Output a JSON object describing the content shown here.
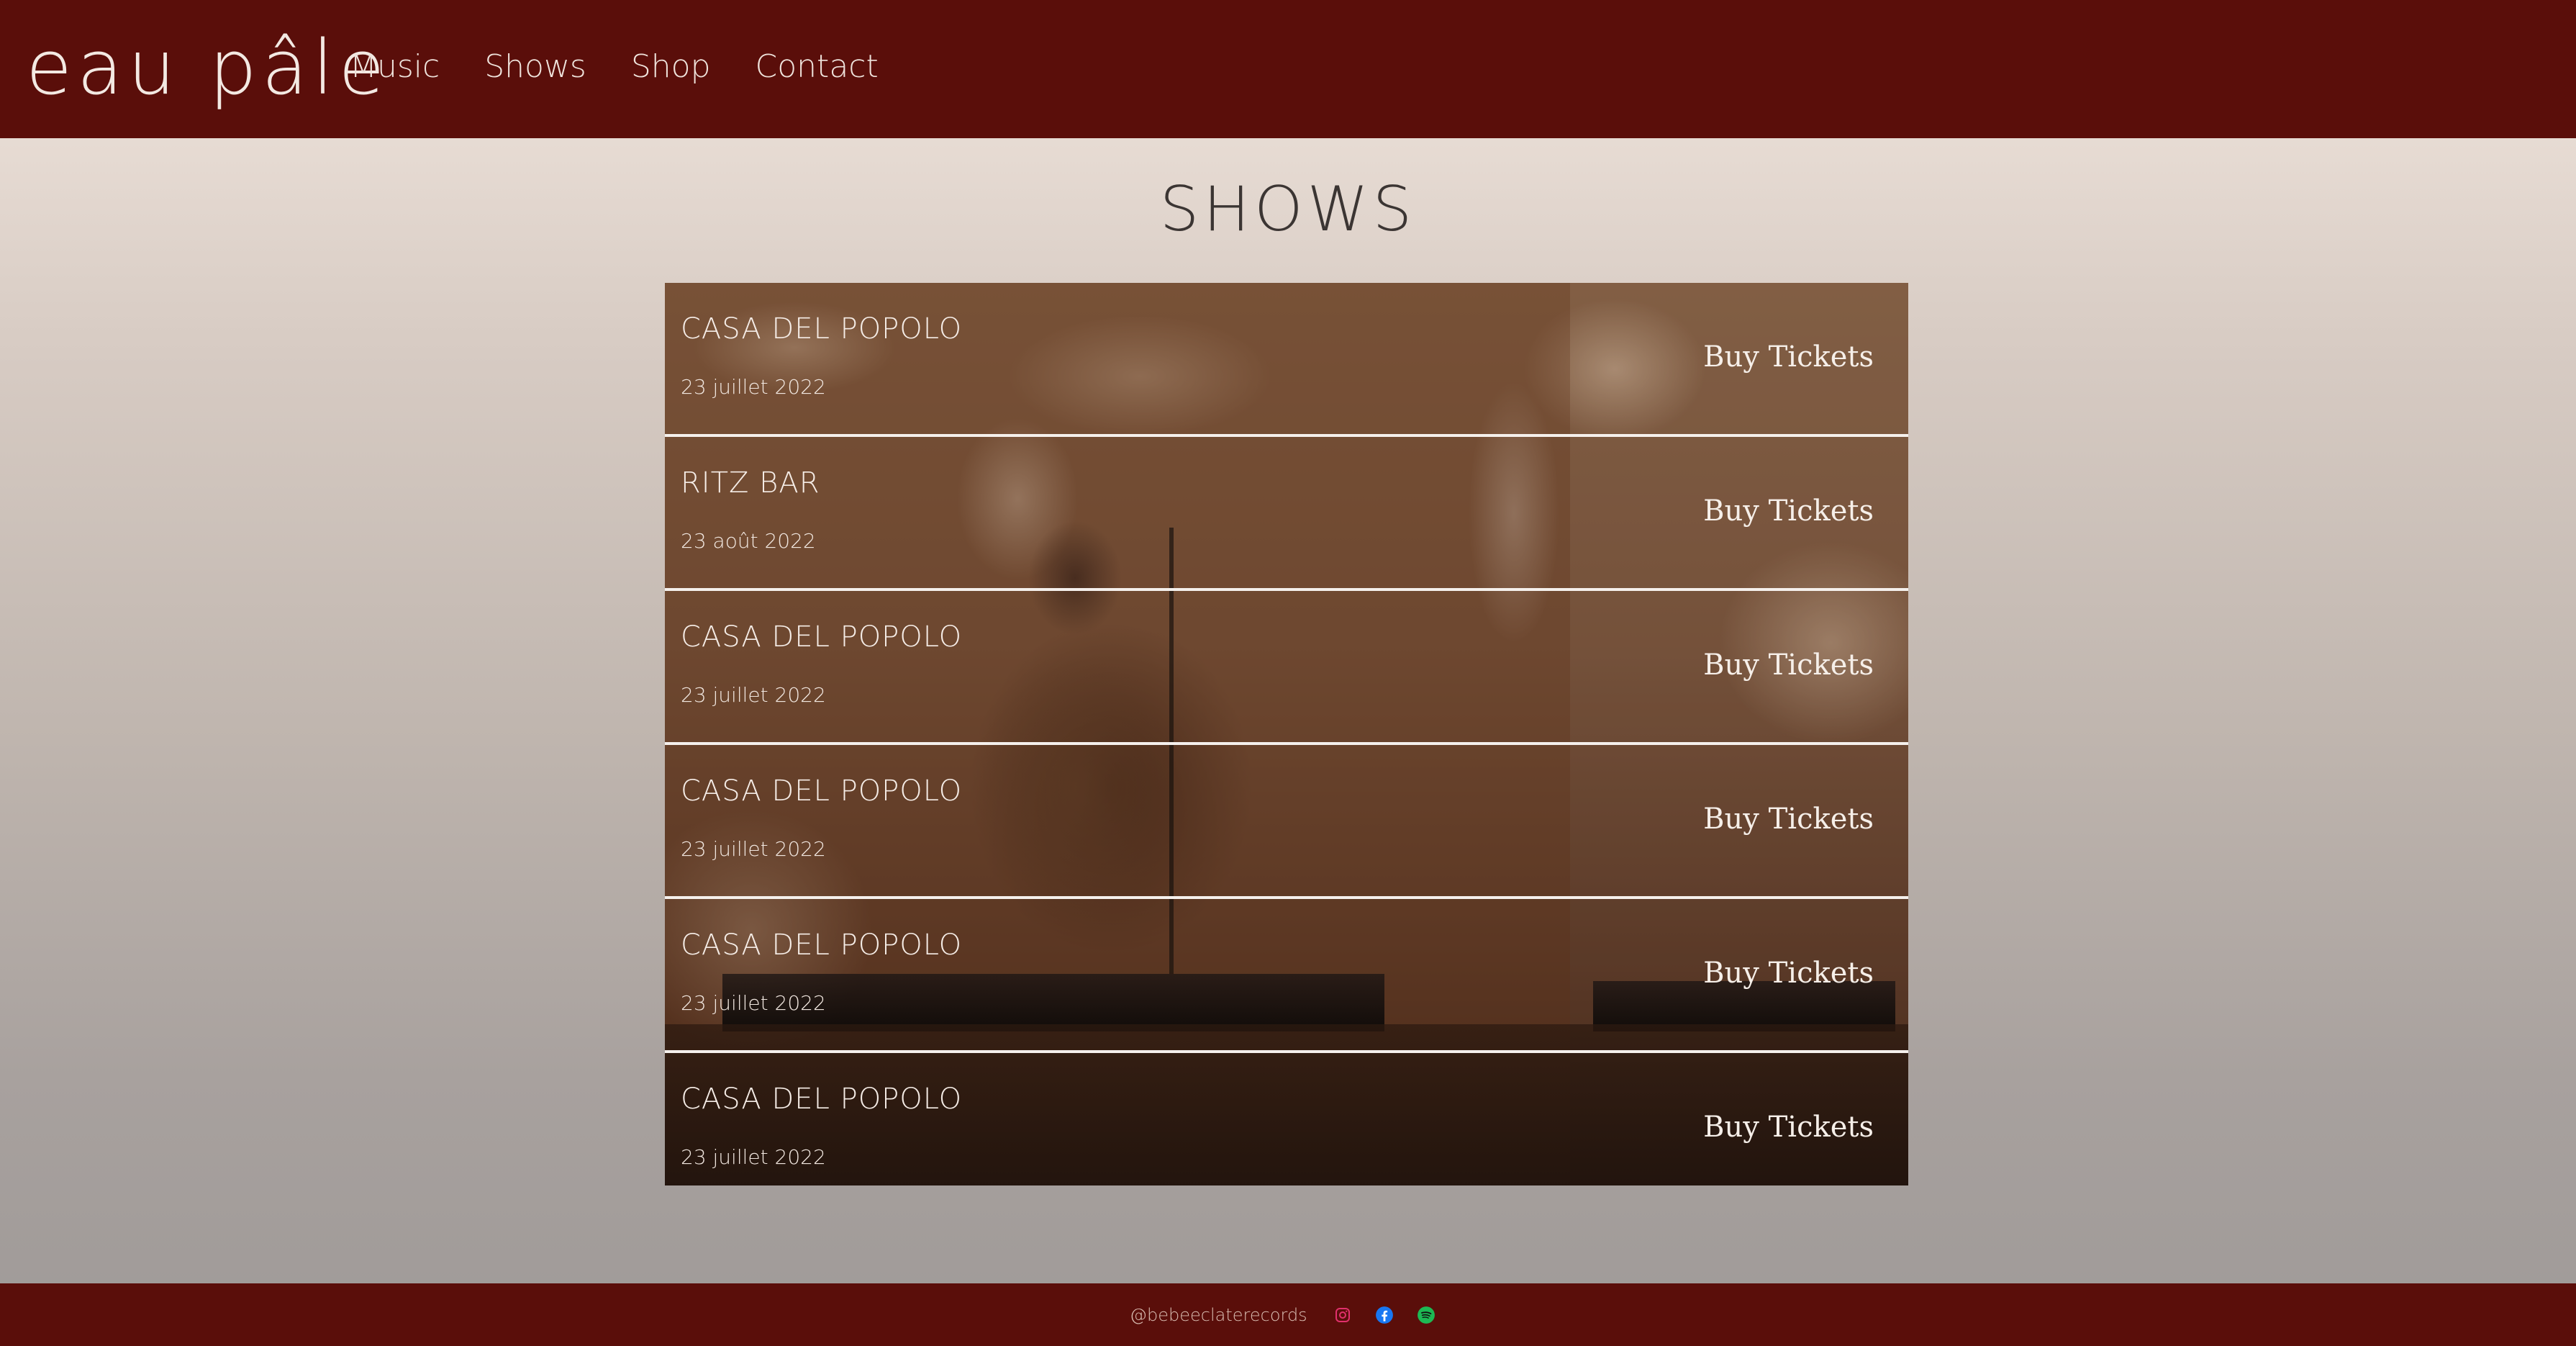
{
  "header": {
    "logo": "eau pâle",
    "nav": [
      "Music",
      "Shows",
      "Shop",
      "Contact"
    ]
  },
  "page": {
    "title": "SHOWS"
  },
  "shows": [
    {
      "venue": "CASA DEL POPOLO",
      "date": "23 juillet 2022",
      "cta": "Buy Tickets"
    },
    {
      "venue": "RITZ BAR",
      "date": "23 août 2022",
      "cta": "Buy Tickets"
    },
    {
      "venue": "CASA DEL POPOLO",
      "date": "23 juillet 2022",
      "cta": "Buy Tickets"
    },
    {
      "venue": "CASA DEL POPOLO",
      "date": "23 juillet 2022",
      "cta": "Buy Tickets"
    },
    {
      "venue": "CASA DEL POPOLO",
      "date": "23 juillet 2022",
      "cta": "Buy Tickets"
    },
    {
      "venue": "CASA DEL POPOLO",
      "date": "23 juillet 2022",
      "cta": "Buy Tickets"
    }
  ],
  "footer": {
    "handle": "@bebeeclaterecords",
    "icons": [
      "instagram-icon",
      "facebook-icon",
      "spotify-icon"
    ]
  },
  "colors": {
    "header_bg": "#5a0e0a",
    "footer_bg": "#5a0e0a",
    "page_bg_top": "#f1e6de",
    "page_bg_bottom": "#9f9a98",
    "text_light": "#f5ece6",
    "title": "#3b3533",
    "instagram": "#e1306c",
    "facebook": "#1877f2",
    "spotify": "#1db954"
  }
}
